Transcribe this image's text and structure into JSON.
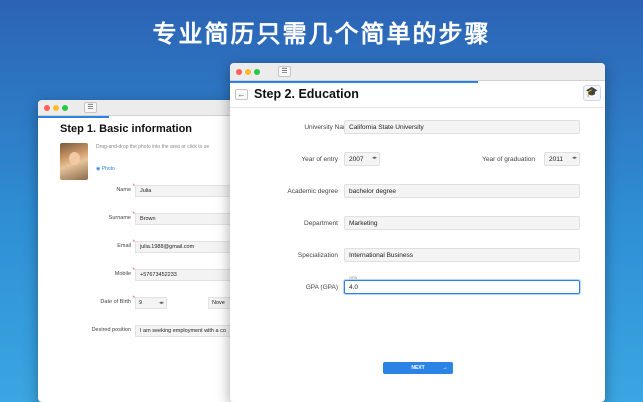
{
  "headline": "专业简历只需几个简单的步骤",
  "window1": {
    "menu_icon": "hamburger-icon",
    "title": "Step 1. Basic information",
    "photo_hint": "Drag-and-drop the photo into the area or click to se",
    "photo_link": "Photo",
    "fields": [
      {
        "label": "Name",
        "value": "Julia",
        "required": "*"
      },
      {
        "label": "Surname",
        "value": "Brown",
        "required": "*"
      },
      {
        "label": "Email",
        "value": "julia.1988@gmail.com",
        "required": "*"
      },
      {
        "label": "Mobile",
        "value": "+57673452233",
        "required": "*"
      }
    ],
    "dob": {
      "label": "Date of Birth",
      "required": "*",
      "day": "9",
      "month": "Nove"
    },
    "desired": {
      "label": "Desired position",
      "value": "I am seeking employment with a co"
    }
  },
  "window2": {
    "menu_icon": "hamburger-icon",
    "back_icon": "arrow-left-icon",
    "title": "Step 2. Education",
    "grad_icon": "graduation-cap-icon",
    "university": {
      "label": "University Name",
      "value": "California State University"
    },
    "year_entry": {
      "label": "Year of entry",
      "value": "2007"
    },
    "year_grad": {
      "label": "Year of graduation",
      "value": "2011"
    },
    "degree": {
      "label": "Academic degree",
      "value": "bachelor degree"
    },
    "department": {
      "label": "Department",
      "value": "Marketing"
    },
    "specialization": {
      "label": "Specialization",
      "value": "International Business"
    },
    "gpa": {
      "label": "GPA (GPA)",
      "value": "4.0",
      "float_label": "GPA"
    },
    "next_label": "NEXT",
    "progress": 0.66
  },
  "colors": {
    "accent": "#2c83e6",
    "background_top": "#2c63b4",
    "background_bottom": "#3aa6e2"
  }
}
